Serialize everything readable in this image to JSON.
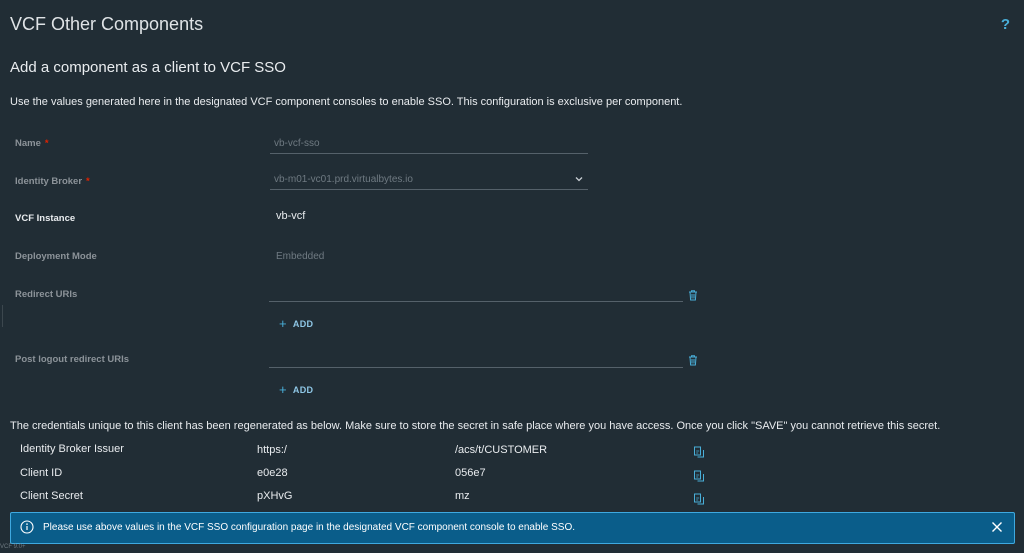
{
  "page": {
    "title": "VCF Other Components",
    "help_label": "?",
    "subtitle": "Add a component as a client to VCF SSO",
    "description": "Use the values generated here in the designated VCF component consoles to enable SSO. This configuration is exclusive per component."
  },
  "form": {
    "name": {
      "label": "Name",
      "required_mark": "*",
      "value": "vb-vcf-sso"
    },
    "identity_broker": {
      "label": "Identity Broker",
      "required_mark": "*",
      "value": "vb-m01-vc01.prd.virtualbytes.io"
    },
    "vcf_instance": {
      "label": "VCF Instance",
      "value": "vb-vcf"
    },
    "deployment_mode": {
      "label": "Deployment Mode",
      "value": "Embedded"
    },
    "redirect_uris": {
      "label": "Redirect URIs",
      "value": "",
      "add_label": "ADD"
    },
    "post_logout_uris": {
      "label": "Post logout redirect URIs",
      "value": "",
      "add_label": "ADD"
    }
  },
  "credentials": {
    "note": "The credentials unique to this client has been regenerated as below. Make sure to store the secret in safe place where you have access. Once you click \"SAVE\" you cannot retrieve this secret.",
    "rows": [
      {
        "label": "Identity Broker Issuer",
        "value_start": "https:/",
        "value_end": "/acs/t/CUSTOMER"
      },
      {
        "label": "Client ID",
        "value_start": "e0e28",
        "value_end": "056e7"
      },
      {
        "label": "Client Secret",
        "value_start": "pXHvG",
        "value_end": "mz"
      }
    ]
  },
  "banner": {
    "text": "Please use above values in the VCF SSO configuration page in the designated VCF component console to enable SSO."
  },
  "footer": {
    "text": "VCF 9.0+"
  },
  "icons": {
    "help": "help-icon",
    "chevron": "chevron-down-icon",
    "trash": "trash-icon",
    "plus": "plus-icon",
    "copy": "copy-icon",
    "info": "info-icon",
    "close": "close-icon"
  },
  "colors": {
    "background": "#212d35",
    "accent": "#49afd9",
    "banner_bg": "#0a5d8a",
    "required": "#e12200"
  }
}
